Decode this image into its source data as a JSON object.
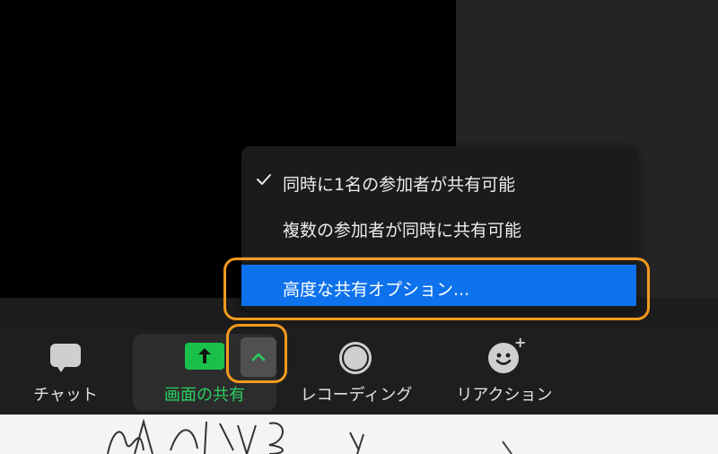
{
  "toolbar": {
    "chat_label": "チャット",
    "share_label": "画面の共有",
    "record_label": "レコーディング",
    "reactions_label": "リアクション"
  },
  "share_menu": {
    "items": [
      {
        "label": "同時に1名の参加者が共有可能",
        "checked": true
      },
      {
        "label": "複数の参加者が同時に共有可能",
        "checked": false
      },
      {
        "label": "高度な共有オプション...",
        "highlighted": true
      }
    ]
  },
  "icons": {
    "chat": "chat-bubble-icon",
    "share": "share-screen-arrow-icon",
    "caret": "chevron-up-icon",
    "record": "record-icon",
    "reactions": "emoji-add-icon",
    "check": "checkmark-icon"
  },
  "colors": {
    "share_green": "#19c14a",
    "highlight_blue": "#0e72ed",
    "annotation_orange": "#f39a1c",
    "toolbar_bg": "#1e1e1e"
  }
}
